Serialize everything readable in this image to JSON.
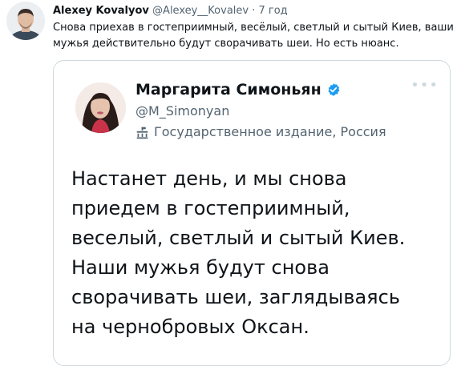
{
  "tweet": {
    "author_name": "Alexey Kovalyov",
    "author_handle": "@Alexey__Kovalev",
    "separator": "·",
    "time": "7 год",
    "text": "Снова приехав в гостеприимный, весёлый, светлый и сытый Киев, ваши мужья действительно будут сворачивать шеи. Но есть нюанс."
  },
  "quoted_tweet": {
    "author_name": "Маргарита Симоньян",
    "author_handle": "@M_Simonyan",
    "label": "Государственное издание, Россия",
    "text_lines": [
      "Настанет день, и мы снова",
      "приедем в гостеприимный,",
      "веселый, светлый и сытый Киев.",
      "Наши мужья будут снова",
      "сворачивать шеи, заглядываясь",
      "на чернобровых Оксан."
    ]
  },
  "colors": {
    "verified": "#1d9bf0",
    "secondary_text": "#536471",
    "border": "#cfd9de"
  },
  "icons": [
    "verified-badge-icon",
    "state-media-icon",
    "more-icon"
  ]
}
